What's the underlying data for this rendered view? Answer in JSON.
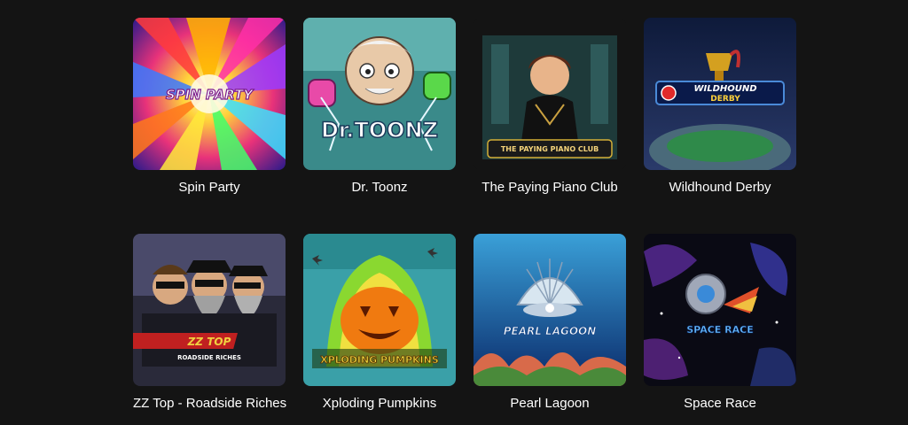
{
  "games": [
    {
      "title": "Spin Party",
      "logo": "SPIN PARTY"
    },
    {
      "title": "Dr. Toonz",
      "logo": "Dr.TOONZ"
    },
    {
      "title": "The Paying Piano Club",
      "logo": "THE PAYING PIANO CLUB"
    },
    {
      "title": "Wildhound Derby",
      "logo_line1": "WILDHOUND",
      "logo_line2": "DERBY"
    },
    {
      "title": "ZZ Top - Roadside Riches",
      "logo_line1": "ZZ TOP",
      "logo_line2": "ROADSIDE RICHES"
    },
    {
      "title": "Xploding Pumpkins",
      "logo": "XPLODING PUMPKINS"
    },
    {
      "title": "Pearl Lagoon",
      "logo": "PEARL LAGOON"
    },
    {
      "title": "Space Race",
      "logo": "SPACE RACE"
    }
  ],
  "colors": {
    "page_background": "#141414",
    "caption_text": "#ffffff"
  }
}
